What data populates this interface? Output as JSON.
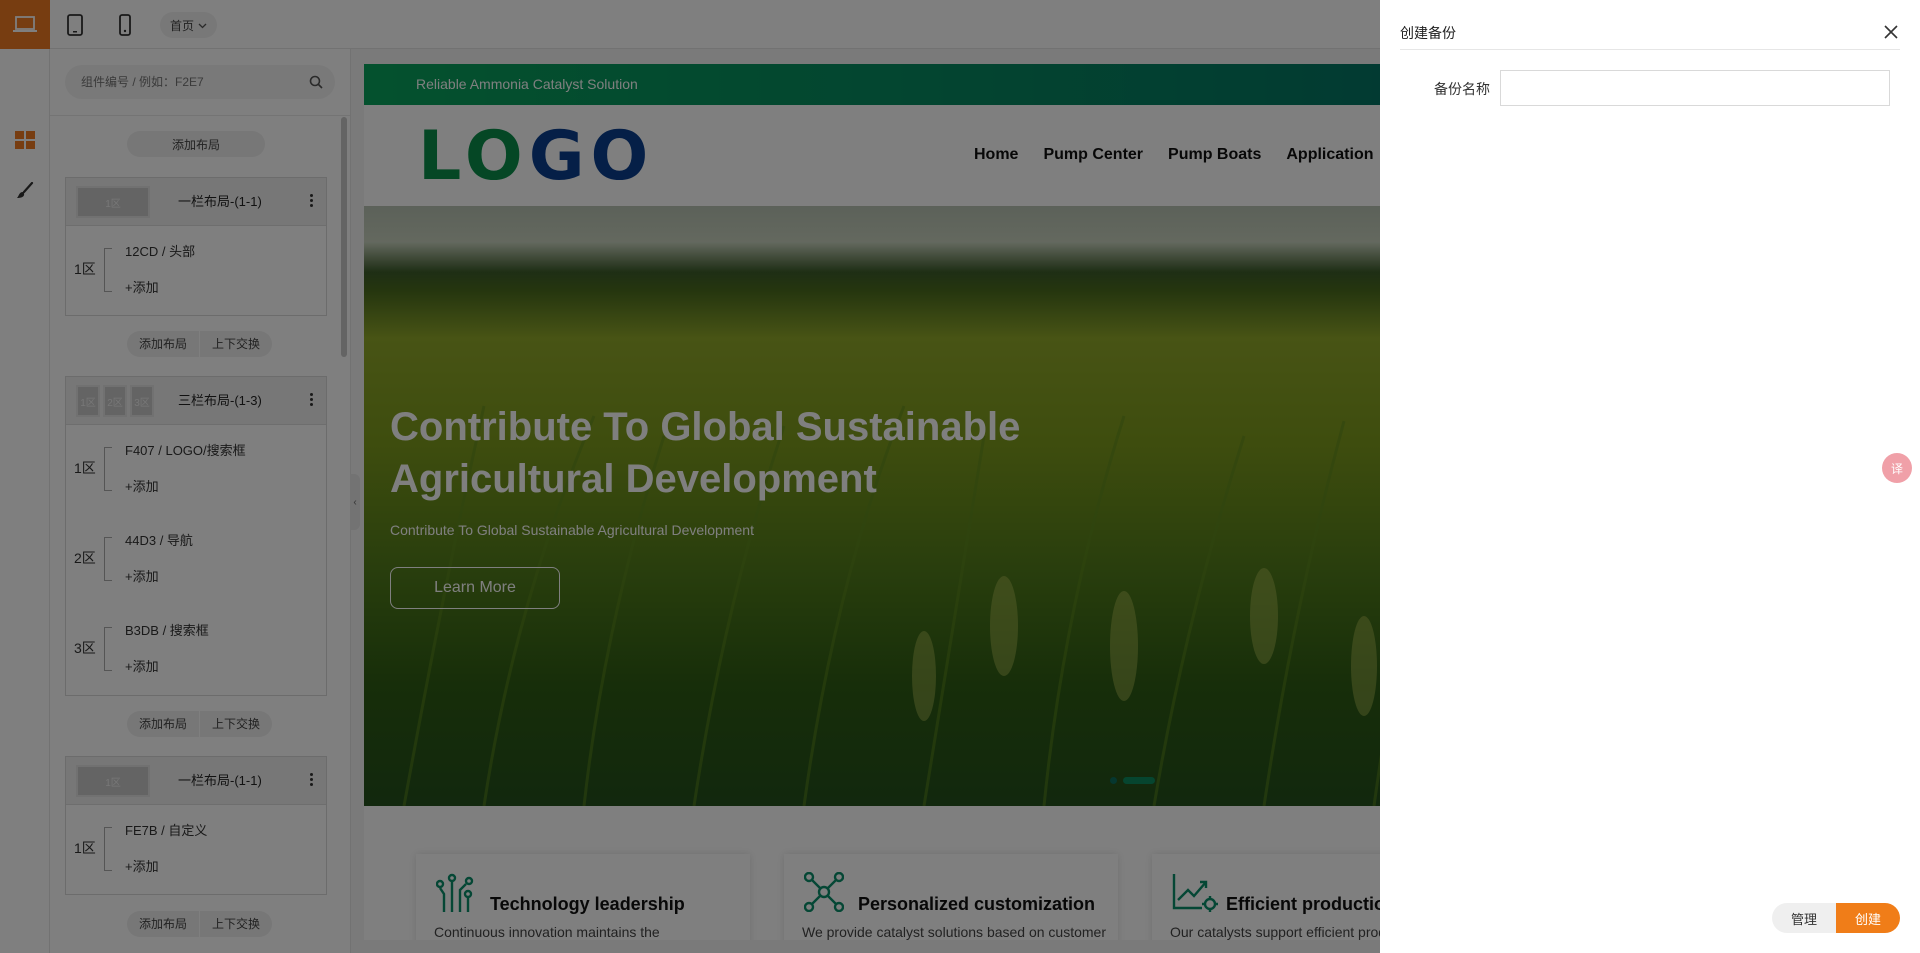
{
  "toolbar": {
    "devices": [
      "desktop-icon",
      "tablet-icon",
      "phone-icon"
    ],
    "active_device": "desktop-icon",
    "page_select": "首页",
    "accent": "#ee7a23"
  },
  "rail": {
    "items": [
      "layout-grid-icon",
      "brush-icon"
    ]
  },
  "panel": {
    "search_placeholder": "组件编号 / 例如：F2E7",
    "add_layout": "添加布局",
    "swap_updown": "上下交换",
    "add_item": "+添加",
    "cards": [
      {
        "title": "一栏布局-(1-1)",
        "thumbs": [
          "1区"
        ],
        "zones": [
          {
            "label": "1区",
            "item": "12CD / 头部"
          }
        ]
      },
      {
        "title": "三栏布局-(1-3)",
        "thumbs": [
          "1区",
          "2区",
          "3区"
        ],
        "zones": [
          {
            "label": "1区",
            "item": "F407 / LOGO/搜索框"
          },
          {
            "label": "2区",
            "item": "44D3 / 导航"
          },
          {
            "label": "3区",
            "item": "B3DB / 搜索框"
          }
        ]
      },
      {
        "title": "一栏布局-(1-1)",
        "thumbs": [
          "1区"
        ],
        "zones": [
          {
            "label": "1区",
            "item": "FE7B / 自定义"
          }
        ]
      }
    ]
  },
  "preview": {
    "promo_text": "Reliable Ammonia Catalyst Solution",
    "logo": "LOGO",
    "nav": [
      "Home",
      "Pump Center",
      "Pump Boats",
      "Application"
    ],
    "hero": {
      "title": "Contribute To Global Sustainable Agricultural Development",
      "subtitle": "Contribute To Global Sustainable Agricultural Development",
      "button": "Learn More"
    },
    "features": [
      {
        "icon": "circuit-icon",
        "title": "Technology leadership",
        "desc": "Continuous innovation maintains the"
      },
      {
        "icon": "network-icon",
        "title": "Personalized customization",
        "desc": "We provide catalyst solutions based on customer"
      },
      {
        "icon": "growth-chart-icon",
        "title": "Efficient production",
        "desc": "Our catalysts support efficient prod"
      }
    ]
  },
  "drawer": {
    "title": "创建备份",
    "field_label": "备份名称",
    "field_value": "",
    "manage": "管理",
    "create": "创建",
    "create_color": "#f07d18"
  },
  "lang_fab": "译"
}
